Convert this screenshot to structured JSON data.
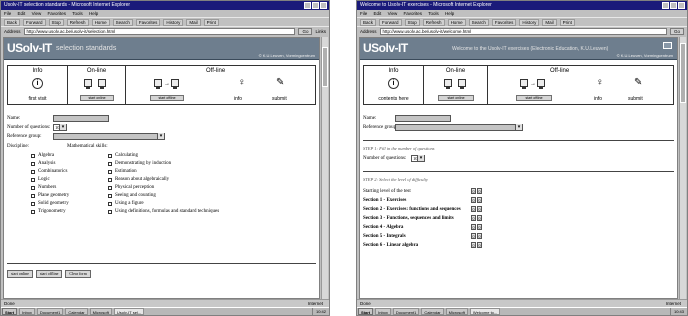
{
  "left": {
    "window_title": "Usolv-IT selection standards - Microsoft Internet Explorer",
    "menu": [
      "File",
      "Edit",
      "View",
      "Favorites",
      "Tools",
      "Help"
    ],
    "toolbar": [
      "Back",
      "Forward",
      "Stop",
      "Refresh",
      "Home",
      "Search",
      "Favorites",
      "History",
      "Mail",
      "Print"
    ],
    "address_label": "Address",
    "address": "http://www.usolv.ac.be/usolv-it/selection.html",
    "go_label": "Go",
    "links_label": "Links",
    "banner": {
      "logo": "USolv-IT",
      "subtitle": "selection standards",
      "copyright": "© K.U.Leuven, Vormingcentrum"
    },
    "nav": {
      "info_head": "Info",
      "info_foot": "first visit",
      "online_head": "On-line",
      "online_button": "start online",
      "offline_head": "Off-line",
      "offline_button": "start offline",
      "info2_foot": "info",
      "submit_foot": "submit"
    },
    "form": {
      "name_label": "Name:",
      "questions_label": "Number of questions:",
      "questions_value": "10",
      "reference_label": "Reference group:",
      "discipline_label": "Discipline:",
      "math_skills_label": "Mathematical skills:",
      "disciplines": [
        "Algebra",
        "Analysis",
        "Combinatorics",
        "Logic",
        "Numbers",
        "Plane geometry",
        "Solid geometry",
        "Trigonometry"
      ],
      "skills": [
        "Calculating",
        "Demonstrating by induction",
        "Estimation",
        "Reason about algebraically",
        "Physical perception",
        "Seeing and counting",
        "Using a figure",
        "Using definitions, formulas and standard techniques"
      ]
    },
    "buttons": [
      "start online",
      "start offline",
      "Clear form"
    ],
    "status": "Done",
    "zone": "Internet",
    "taskbar": {
      "start": "Start",
      "tasks": [
        "Inbox",
        "Document1",
        "Calendar",
        "Microsoft",
        "Usolv-IT sel..."
      ],
      "clock": "10:42"
    }
  },
  "right": {
    "window_title": "Welcome to Usolv-IT exercises - Microsoft Internet Explorer",
    "menu": [
      "File",
      "Edit",
      "View",
      "Favorites",
      "Tools",
      "Help"
    ],
    "toolbar": [
      "Back",
      "Forward",
      "Stop",
      "Refresh",
      "Home",
      "Search",
      "Favorites",
      "History",
      "Mail",
      "Print"
    ],
    "address_label": "Address",
    "address": "http://www.usolv.ac.be/usolv-it/welcome.html",
    "go_label": "Go",
    "banner": {
      "logo": "USolv-IT",
      "subtitle": "Welcome to the Usolv-IT exercises (Electronic Education, K.U.Leuven)",
      "copyright": "© K.U.Leuven, Vormingcentrum"
    },
    "nav": {
      "info_head": "Info",
      "info_foot": "contents here",
      "online_head": "On-line",
      "online_button": "start online",
      "offline_head": "Off-line",
      "offline_button": "start offline",
      "info2_foot": "info",
      "submit_foot": "submit"
    },
    "form": {
      "name_label": "Name:",
      "reference_label": "Reference group:",
      "section1": "STEP 1: Fill in the number of questions",
      "questions_label": "Number of questions:",
      "questions_value": "10",
      "section2": "STEP 2: Select the level of difficulty",
      "levels": [
        "Starting level of the test",
        "Section 1 - Exercises",
        "Section 2 - Exercises: functions and sequences",
        "Section 3 - Functions, sequences and limits",
        "Section 4 - Algebra",
        "Section 5 - Integrals",
        "Section 6 - Linear algebra"
      ],
      "level_value": "0"
    },
    "status": "Done",
    "zone": "Internet",
    "taskbar": {
      "start": "Start",
      "tasks": [
        "Inbox",
        "Document1",
        "Calendar",
        "Microsoft",
        "Welcome to..."
      ],
      "clock": "10:43"
    }
  }
}
